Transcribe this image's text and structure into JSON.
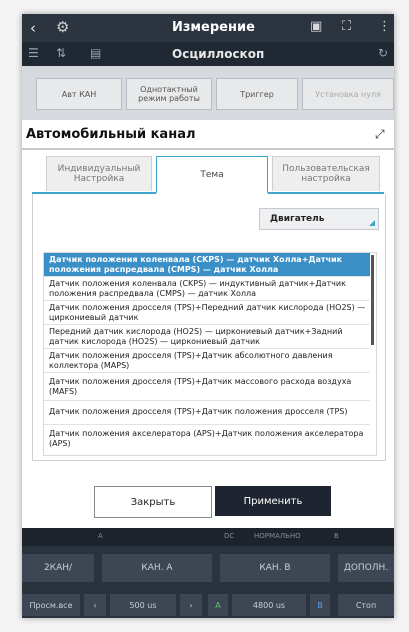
{
  "header": {
    "title": "Измерение",
    "subtitle": "Осциллоскоп"
  },
  "toolbar": {
    "btn1": "Авт КАН",
    "btn2": "Однотактный режим работы",
    "btn3": "Триггер",
    "btn4": "Установка нуля"
  },
  "dialog": {
    "title": "Автомобильный канал",
    "tabs": [
      "Индивидуальный Настройка",
      "Тема",
      "Пользовательская настройка"
    ],
    "select_value": "Двигатель",
    "items": [
      "Датчик положения коленвала (CKPS) — датчик Холла+Датчик положения распредвала (CMPS) — датчик Холла",
      "Датчик положения коленвала (CKPS) — индуктивный датчик+Датчик положения распредвала (CMPS) — датчик Холла",
      "Датчик положения дросселя (TPS)+Передний датчик кислорода (HO2S) — циркониевый датчик",
      "Передний датчик кислорода (HO2S) — циркониевый датчик+Задний датчик кислорода (HO2S) — циркониевый датчик",
      "Датчик положения дросселя (TPS)+Датчик абсолютного давления коллектора (MAPS)",
      "Датчик положения дросселя (TPS)+Датчик массового расхода воздуха (MAFS)",
      "Датчик положения дросселя (TPS)+Датчик положения дросселя (TPS)",
      "Датчик положения акселератора (APS)+Датчик положения акселератора (APS)"
    ],
    "close_label": "Закрыть",
    "apply_label": "Применить"
  },
  "bottom": {
    "strip": [
      "A",
      "DC",
      "НОРМАЛЬНО",
      "B"
    ],
    "row2": [
      "2КАН/",
      "КАН. А",
      "КАН. В",
      "ДОПОЛН."
    ],
    "row3": [
      "Просм.все",
      "500 us",
      "A",
      "4800 us",
      "B",
      "Стоп"
    ]
  }
}
